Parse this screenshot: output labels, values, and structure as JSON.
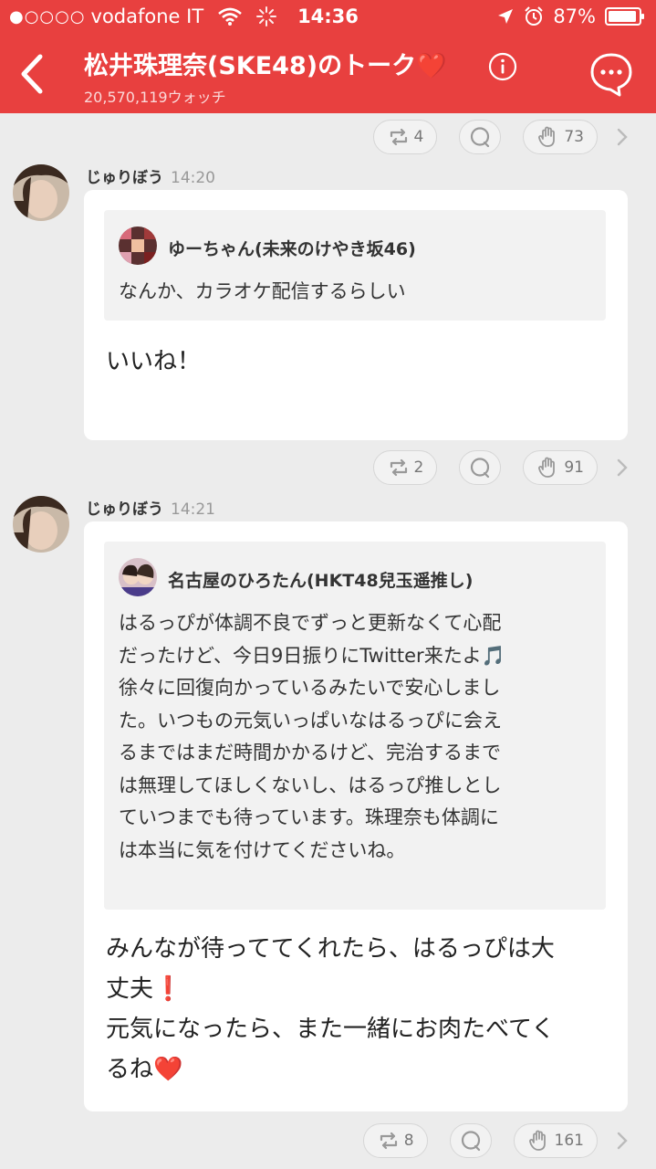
{
  "status_bar": {
    "signal": "●○○○○",
    "carrier": "vodafone IT",
    "time": "14:36",
    "battery": "87%",
    "icons": [
      "wifi-icon",
      "loading-icon",
      "location-arrow-icon",
      "alarm-clock-icon",
      "battery-icon"
    ]
  },
  "header": {
    "title": "松井珠理奈(SKE48)のトーク❤️",
    "watchers": "20,570,119ウォッチ",
    "icons": [
      "back-chevron-icon",
      "info-icon",
      "chat-bubble-icon"
    ]
  },
  "top_actions": {
    "retweets": "4",
    "likes": "73"
  },
  "posts": [
    {
      "author": "じゅりぼう",
      "time": "14:20",
      "quote": {
        "name": "ゆーちゃん(未来のけやき坂46)",
        "text": "なんか、カラオケ配信するらしい"
      },
      "reply": "いいね！",
      "actions": {
        "retweets": "2",
        "likes": "91"
      }
    },
    {
      "author": "じゅりぼう",
      "time": "14:21",
      "quote": {
        "name": "名古屋のひろたん(HKT48兒玉遥推し)",
        "lines": [
          "はるっぴが体調不良でずっと更新なくて心配",
          "だったけど、今日9日振りにTwitter来たよ🎵",
          "徐々に回復向かっているみたいで安心しまし",
          "た。いつもの元気いっぱいなはるっぴに会え",
          "るまではまだ時間かかるけど、完治するまで",
          "は無理してほしくないし、はるっぴ推しとし",
          "ていつまでも待っています。珠理奈も体調に",
          "は本当に気を付けてくださいね。"
        ]
      },
      "reply_lines": [
        "みんなが待っててくれたら、はるっぴは大",
        "丈夫❗",
        "元気になったら、また一緒にお肉たべてく",
        "るね❤️"
      ],
      "actions": {
        "retweets": "8",
        "likes": "161"
      }
    }
  ],
  "colors": {
    "header": "#e8403f",
    "background": "#ececec",
    "card": "#ffffff",
    "quote": "#f2f2f2"
  }
}
